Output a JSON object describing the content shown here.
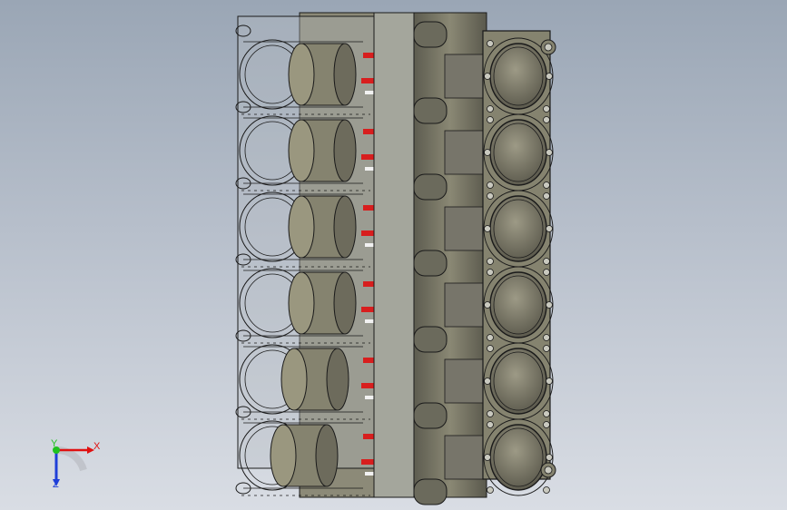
{
  "viewport": {
    "background_top": "#9aa6b5",
    "background_bottom": "#d9dde4"
  },
  "model": {
    "part": "engine-block-v12",
    "cylinders_per_bank": 6,
    "body_color": "#85836f",
    "body_dark": "#55544a",
    "plate_color": "#a4a69c",
    "accent_color": "#d81e1e",
    "edge_color": "#1a1a1a"
  },
  "triad": {
    "x_label": "X",
    "y_label": "Y",
    "z_label": "Z",
    "x_color": "#e01010",
    "y_color": "#1fc21f",
    "z_color": "#1f3fd8"
  }
}
